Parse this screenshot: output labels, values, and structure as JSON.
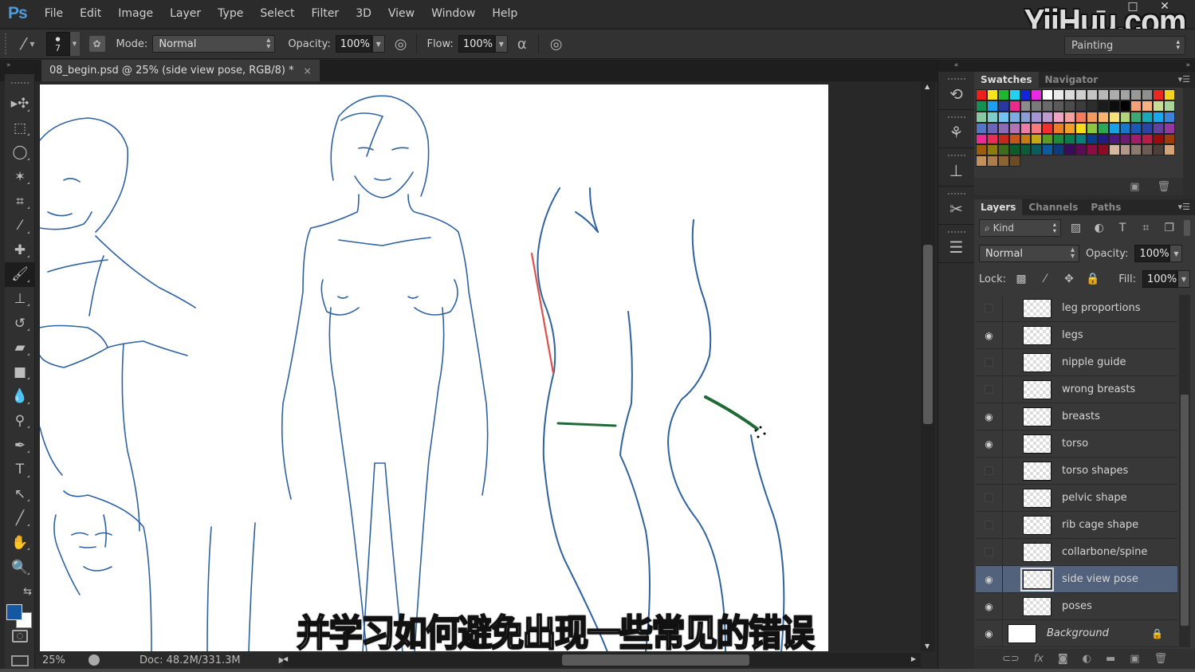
{
  "app": {
    "logo": "Ps",
    "watermark": "YiiHuu.com"
  },
  "menu": [
    "File",
    "Edit",
    "Image",
    "Layer",
    "Type",
    "Select",
    "Filter",
    "3D",
    "View",
    "Window",
    "Help"
  ],
  "window_controls": {
    "minimize": "▁",
    "maximize": "□",
    "close": "✕"
  },
  "options_bar": {
    "brush_size": "7",
    "mode_label": "Mode:",
    "mode_value": "Normal",
    "opacity_label": "Opacity:",
    "opacity_value": "100%",
    "flow_label": "Flow:",
    "flow_value": "100%",
    "workspace": "Painting"
  },
  "document_tab": {
    "title": "08_begin.psd @ 25% (side view pose, RGB/8) *",
    "close": "×"
  },
  "tools": [
    {
      "name": "move-tool-icon",
      "glyph": "▸✣"
    },
    {
      "name": "marquee-tool-icon",
      "glyph": "⬚"
    },
    {
      "name": "lasso-tool-icon",
      "glyph": "◯"
    },
    {
      "name": "magic-wand-tool-icon",
      "glyph": "✶"
    },
    {
      "name": "crop-tool-icon",
      "glyph": "⌗"
    },
    {
      "name": "eyedropper-tool-icon",
      "glyph": "⁄"
    },
    {
      "name": "healing-brush-tool-icon",
      "glyph": "✚"
    },
    {
      "name": "brush-tool-icon",
      "glyph": "🖌"
    },
    {
      "name": "clone-stamp-tool-icon",
      "glyph": "⊥"
    },
    {
      "name": "history-brush-tool-icon",
      "glyph": "↺"
    },
    {
      "name": "eraser-tool-icon",
      "glyph": "▰"
    },
    {
      "name": "gradient-tool-icon",
      "glyph": "■"
    },
    {
      "name": "blur-tool-icon",
      "glyph": "💧"
    },
    {
      "name": "dodge-tool-icon",
      "glyph": "⚲"
    },
    {
      "name": "pen-tool-icon",
      "glyph": "✒"
    },
    {
      "name": "type-tool-icon",
      "glyph": "T"
    },
    {
      "name": "path-selection-tool-icon",
      "glyph": "↖"
    },
    {
      "name": "line-tool-icon",
      "glyph": "╱"
    },
    {
      "name": "hand-tool-icon",
      "glyph": "✋"
    },
    {
      "name": "zoom-tool-icon",
      "glyph": "🔍"
    },
    {
      "name": "swap-colors-icon",
      "glyph": "⇆"
    }
  ],
  "colors": {
    "foreground": "#1557a0",
    "background": "#ffffff",
    "selected_layer": "#52627c",
    "stroke_blue": "#2f62a0",
    "guide_red": "#e0504a",
    "guide_green": "#1f6a35"
  },
  "subtitle": "并学习如何避免出现一些常见的错误",
  "status": {
    "zoom": "25%",
    "doc": "Doc: 48.2M/331.3M"
  },
  "panels": {
    "top_tabs": [
      {
        "label": "Swatches",
        "active": true
      },
      {
        "label": "Navigator",
        "active": false
      }
    ],
    "swatches": [
      "#e8231c",
      "#f5e51a",
      "#20b532",
      "#22d2f0",
      "#1224e0",
      "#e52ce0",
      "#ffffff",
      "#ebebeb",
      "#dcdcdc",
      "#cfcfcf",
      "#c4c4c4",
      "#b8b8b8",
      "#adadad",
      "#a3a3a3",
      "#999999",
      "#8f8f8f",
      "#e52a22",
      "#f0d41e",
      "#149050",
      "#1ea0f0",
      "#2838a0",
      "#e82c8c",
      "#8c8c8c",
      "#7a7a7a",
      "#6a6a6a",
      "#5a5a5a",
      "#4b4b4b",
      "#3c3c3c",
      "#2d2d2d",
      "#1c1c1c",
      "#0d0d0d",
      "#000000",
      "#f5a078",
      "#f7b083",
      "#c8dc96",
      "#a8d49c",
      "#88c8a0",
      "#80cccc",
      "#74c2f0",
      "#7cace0",
      "#8c9cd4",
      "#a496d4",
      "#bc9ccc",
      "#f0a4c4",
      "#f4a0a0",
      "#f47c5c",
      "#f49a5c",
      "#f8b66c",
      "#f8e078",
      "#b4d47c",
      "#3ca878",
      "#18a8b8",
      "#18a8f0",
      "#3c84d8",
      "#5474c8",
      "#6c64b8",
      "#8c6cb8",
      "#b474b4",
      "#f07ca8",
      "#f47c7c",
      "#f0302c",
      "#f07c28",
      "#f49c2c",
      "#f8dc1c",
      "#8cc83c",
      "#2ca850",
      "#18a0e8",
      "#1878d0",
      "#1c58b8",
      "#2c44a8",
      "#6440a0",
      "#9438a0",
      "#ec2c94",
      "#ec2c54",
      "#c8281c",
      "#c4581c",
      "#c47c18",
      "#c4a818",
      "#5c9c24",
      "#1c8c3c",
      "#0c7c4c",
      "#0c7c7c",
      "#0c3c88",
      "#241c80",
      "#4c1c7c",
      "#6c1c70",
      "#a41c6c",
      "#b81c48",
      "#9c0c0c",
      "#9c3c0c",
      "#9c5c0c",
      "#8c7c0c",
      "#3c6c1c",
      "#0c5c2c",
      "#0c5c3c",
      "#0c5c5c",
      "#0c5c9c",
      "#0c3c7c",
      "#3c0c5c",
      "#5c0c54",
      "#8c0c44",
      "#8c0c24",
      "#d4b8a0",
      "#b0988c",
      "#8c7c70",
      "#6c5c54",
      "#4c4038",
      "#d4a478",
      "#c4905c",
      "#ac7c4c",
      "#8c6434",
      "#6c4c24"
    ],
    "layer_tabs": [
      {
        "label": "Layers",
        "active": true
      },
      {
        "label": "Channels",
        "active": false
      },
      {
        "label": "Paths",
        "active": false
      }
    ],
    "kind_label": "Kind",
    "blend_mode": "Normal",
    "opacity_label": "Opacity:",
    "opacity_value": "100%",
    "lock_label": "Lock:",
    "fill_label": "Fill:",
    "fill_value": "100%",
    "layers": [
      {
        "name": "leg proportions",
        "visible": false,
        "selected": false
      },
      {
        "name": "legs",
        "visible": true,
        "selected": false
      },
      {
        "name": "nipple guide",
        "visible": false,
        "selected": false
      },
      {
        "name": "wrong breasts",
        "visible": false,
        "selected": false
      },
      {
        "name": "breasts",
        "visible": true,
        "selected": false
      },
      {
        "name": "torso",
        "visible": true,
        "selected": false
      },
      {
        "name": "torso shapes",
        "visible": false,
        "selected": false
      },
      {
        "name": "pelvic shape",
        "visible": false,
        "selected": false
      },
      {
        "name": "rib cage shape",
        "visible": false,
        "selected": false
      },
      {
        "name": "collarbone/spine",
        "visible": false,
        "selected": false
      },
      {
        "name": "side view pose",
        "visible": true,
        "selected": true
      },
      {
        "name": "poses",
        "visible": true,
        "selected": false
      },
      {
        "name": "Background",
        "visible": true,
        "selected": false,
        "locked": true,
        "italic": true
      }
    ]
  }
}
